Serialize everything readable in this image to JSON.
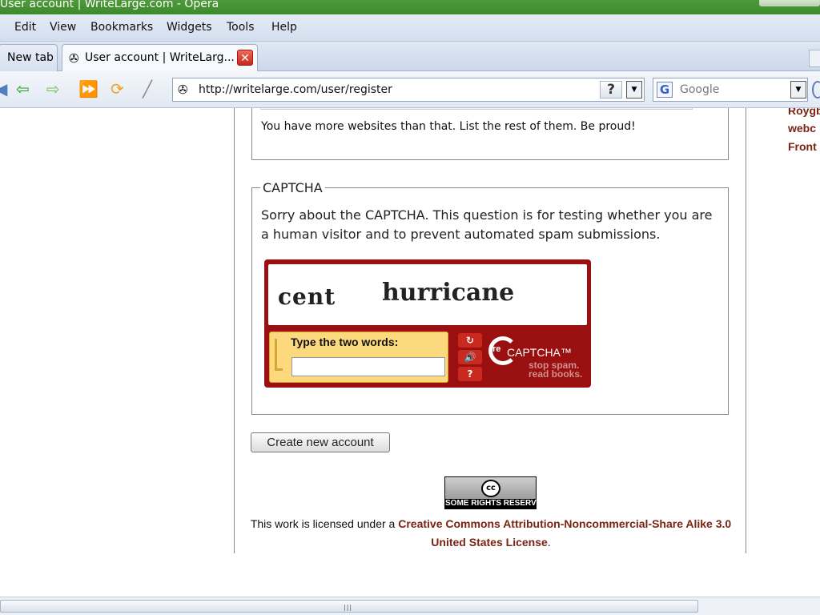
{
  "window": {
    "title": "User account | WriteLarge.com - Opera"
  },
  "menu": [
    "Edit",
    "View",
    "Bookmarks",
    "Widgets",
    "Tools",
    "Help"
  ],
  "tabs": [
    {
      "label": "New tab"
    },
    {
      "label": "User account | WriteLarg..."
    }
  ],
  "address": {
    "url": "http://writelarge.com/user/register",
    "help": "?"
  },
  "search": {
    "placeholder": "Google",
    "engine_letter": "G"
  },
  "page": {
    "websites_description": "You have more websites than that. List the rest of them. Be proud!",
    "captcha": {
      "legend": "CAPTCHA",
      "text": "Sorry about the CAPTCHA. This question is for testing whether you are a human visitor and to prevent automated spam submissions.",
      "word1": "cent",
      "word2": "hurricane",
      "input_label": "Type the two words:",
      "logo_re": "re",
      "logo_name": "CAPTCHA™",
      "tagline1": "stop spam.",
      "tagline2": "read books."
    },
    "submit_label": "Create new account",
    "cc_badge": {
      "logo": "cc",
      "text": "SOME RIGHTS RESERVED"
    },
    "license_prefix": "This work is licensed under a ",
    "license_link": "Creative Commons Attribution-Noncommercial-Share Alike 3.0 United States License",
    "license_suffix": "."
  },
  "sidebar_right": [
    "Roygb",
    "webc",
    "Front"
  ]
}
